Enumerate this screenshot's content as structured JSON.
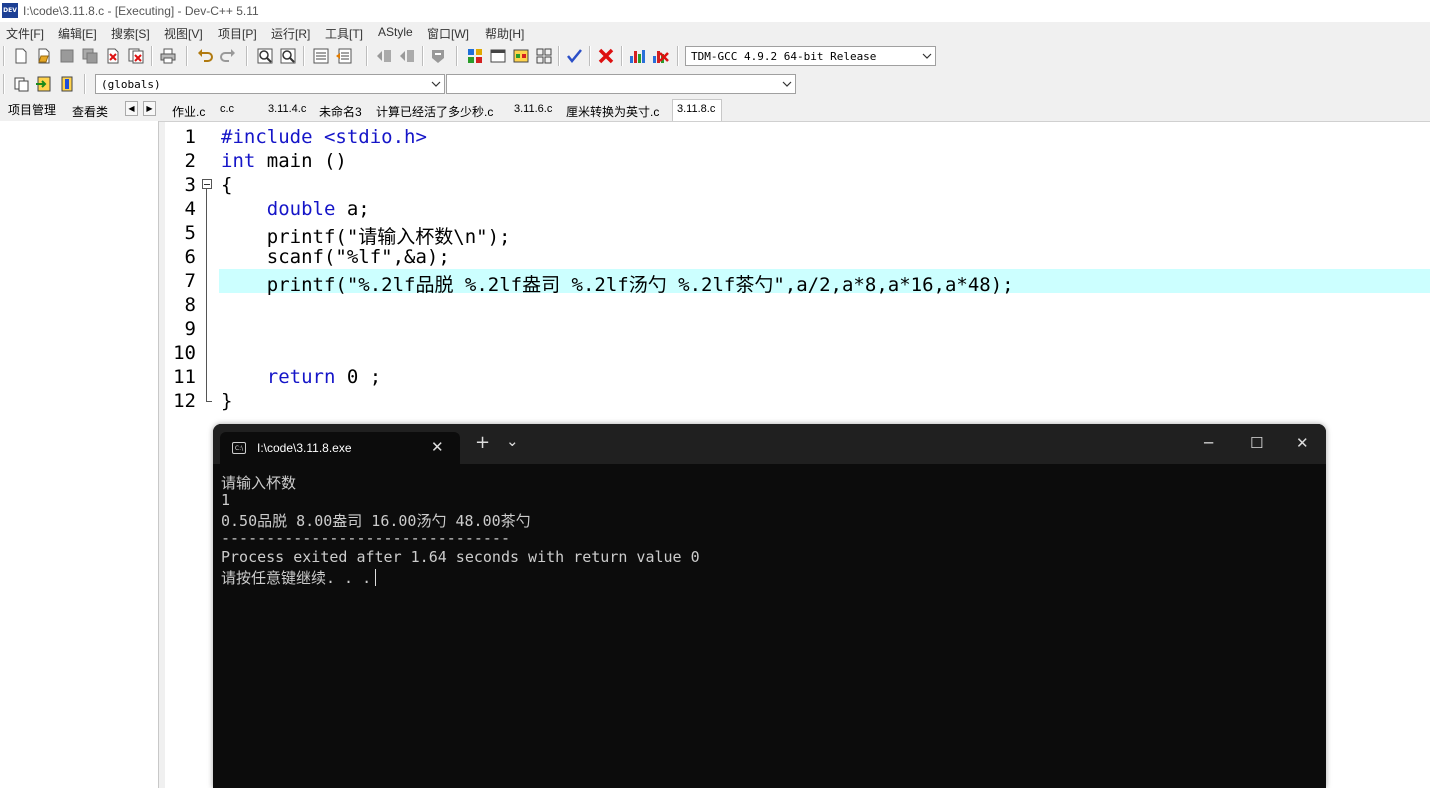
{
  "window": {
    "title": "I:\\code\\3.11.8.c - [Executing] - Dev-C++ 5.11",
    "app_icon_text": "DEV"
  },
  "menu": [
    "文件[F]",
    "编辑[E]",
    "搜索[S]",
    "视图[V]",
    "项目[P]",
    "运行[R]",
    "工具[T]",
    "AStyle",
    "窗口[W]",
    "帮助[H]"
  ],
  "compiler_select": "TDM-GCC 4.9.2 64-bit Release",
  "scope_select": "(globals)",
  "function_select": "",
  "panel_tabs": [
    "项目管理",
    "查看类"
  ],
  "file_tabs": [
    "作业.c",
    "c.c",
    "3.11.4.c",
    "未命名3",
    "计算已经活了多少秒.c",
    "3.11.6.c",
    "厘米转换为英寸.c",
    "3.11.8.c"
  ],
  "active_file_tab": "3.11.8.c",
  "code": {
    "line_numbers": [
      "1",
      "2",
      "3",
      "4",
      "5",
      "6",
      "7",
      "8",
      "9",
      "10",
      "11",
      "12"
    ],
    "l1": "#include <stdio.h>",
    "l2_kw": "int",
    "l2_rest": " main ()",
    "l3": "{",
    "l4_indent": "    ",
    "l4_kw": "double",
    "l4_rest": " a;",
    "l5": "    printf(\"请输入杯数\\n\");",
    "l6": "    scanf(\"%lf\",&a);",
    "l7": "    printf(\"%.2lf品脱 %.2lf盎司 %.2lf汤勺 %.2lf茶勺\",a/2,a*8,a*16,a*48);",
    "l11_indent": "    ",
    "l11_kw": "return",
    "l11_rest": " 0 ;",
    "l12": "}",
    "highlighted_line": 7
  },
  "console": {
    "tab_title": "I:\\code\\3.11.8.exe",
    "tab_icon_text": "C:\\",
    "new_tab": "+",
    "dropdown": "⌄",
    "minimize": "─",
    "maximize": "☐",
    "close": "✕",
    "tab_close": "✕",
    "lines": [
      "请输入杯数",
      "1",
      "0.50品脱 8.00盎司 16.00汤勺 48.00茶勺",
      "--------------------------------",
      "Process exited after 1.64 seconds with return value 0",
      "请按任意键继续. . ."
    ]
  }
}
